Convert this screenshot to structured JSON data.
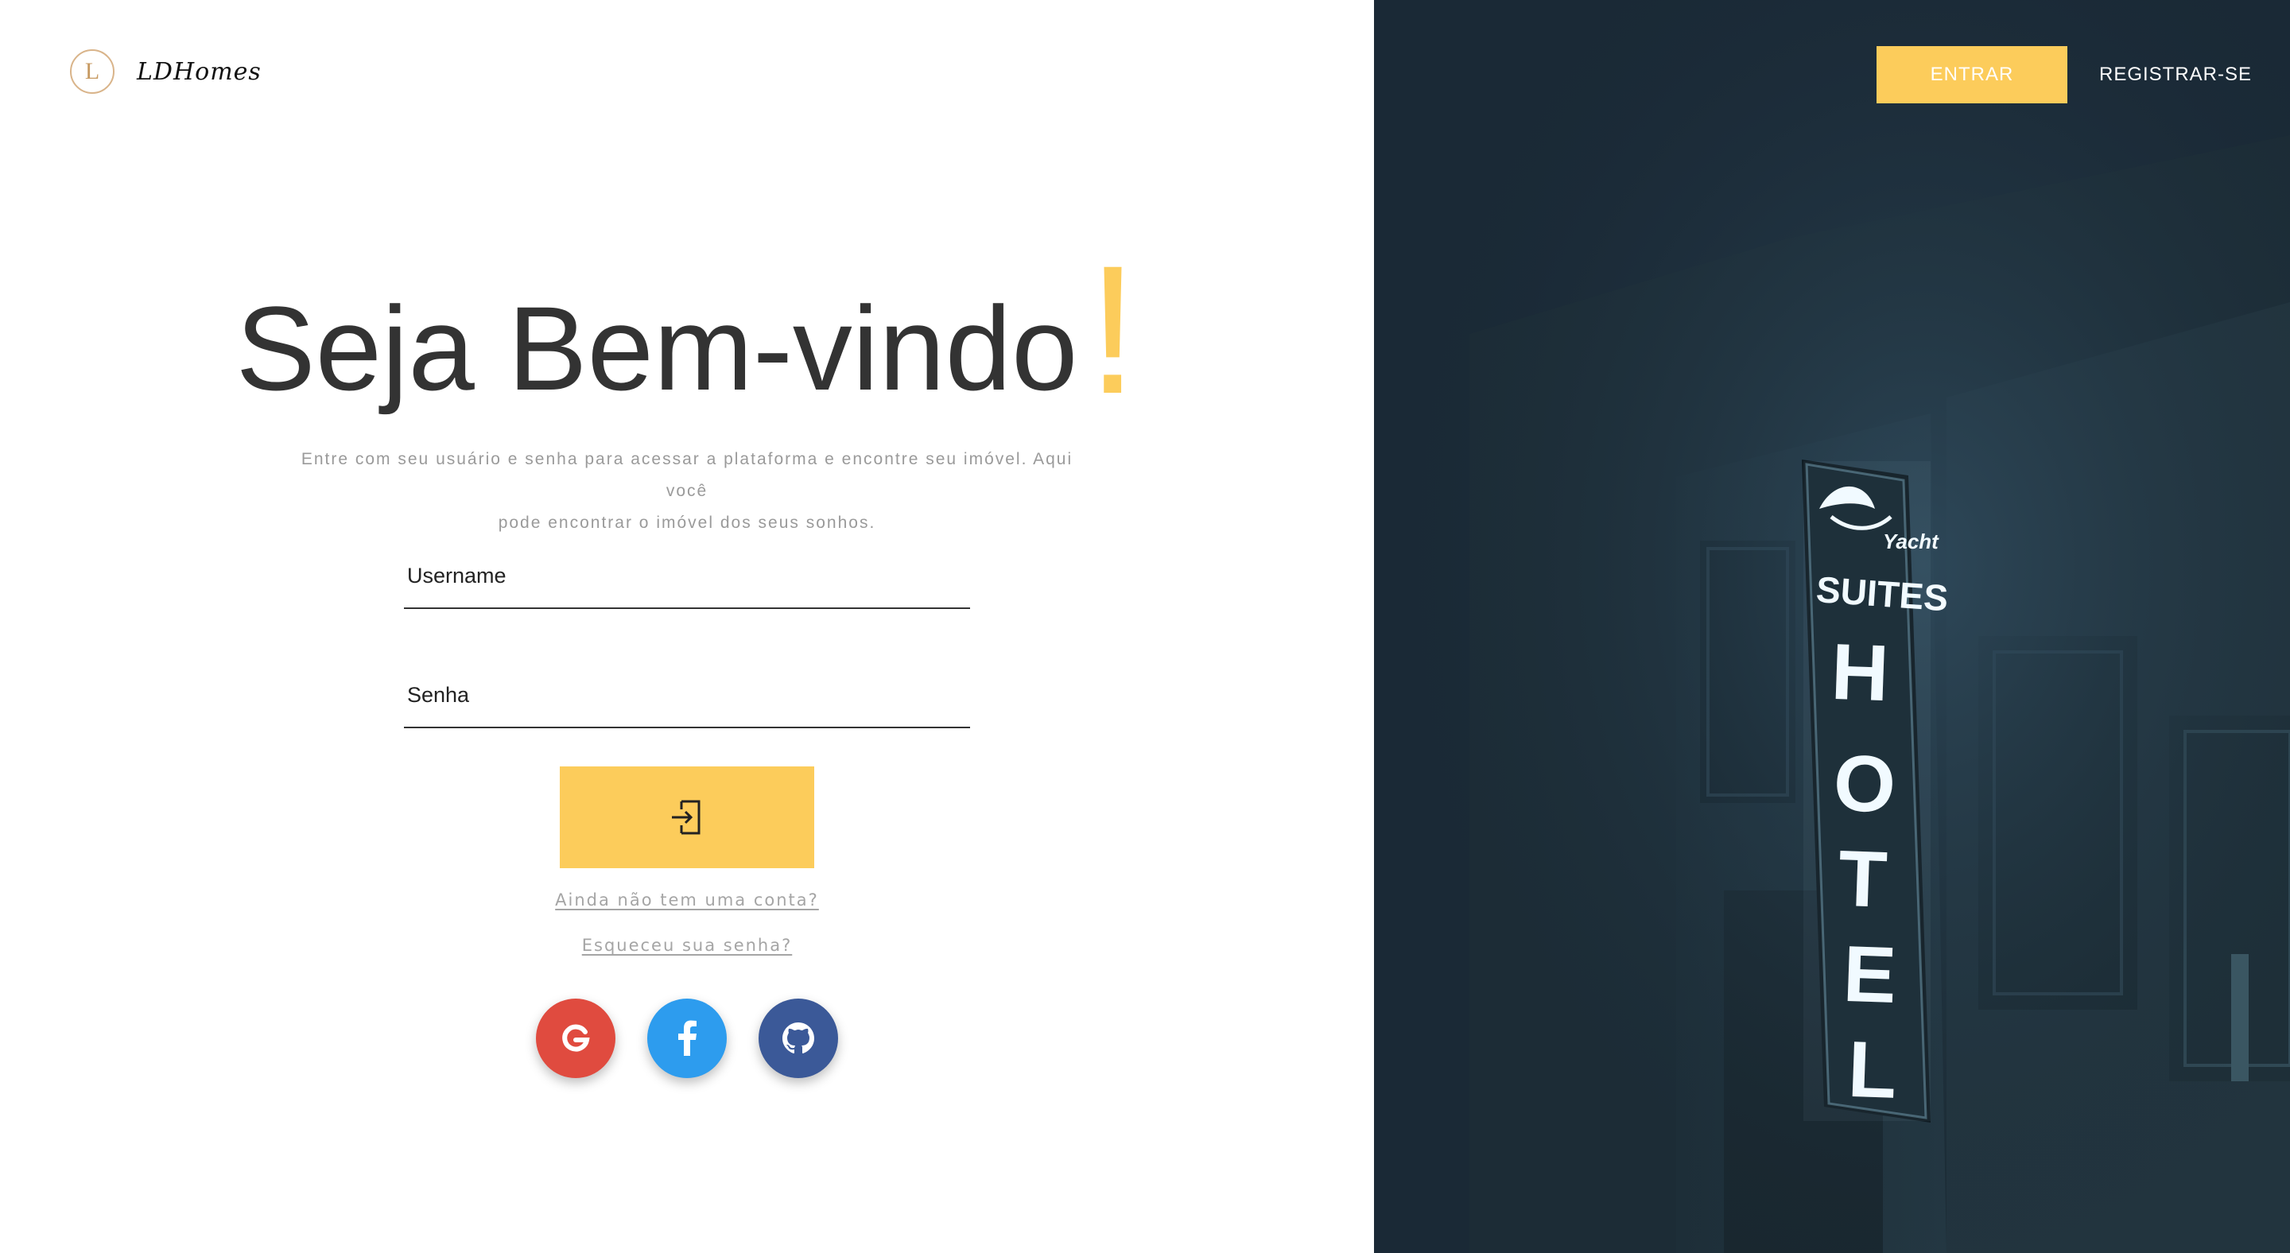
{
  "brand": {
    "logo_letter": "L",
    "name": "LDHomes"
  },
  "hero": {
    "title": "Seja Bem-vindo",
    "title_accent": "!",
    "subtitle_line1": "Entre com seu usuário e senha para acessar a plataforma e encontre seu imóvel. Aqui você",
    "subtitle_line2": "pode encontrar o imóvel dos seus sonhos."
  },
  "form": {
    "username_placeholder": "Username",
    "username_value": "",
    "password_placeholder": "Senha",
    "password_value": "",
    "submit_icon": "login-icon"
  },
  "links": {
    "register": "Ainda não tem uma conta?",
    "forgot": "Esqueceu sua senha?"
  },
  "socials": [
    {
      "name": "google",
      "icon": "google-icon",
      "color": "#e04b3f"
    },
    {
      "name": "facebook",
      "icon": "facebook-icon",
      "color": "#2d9cee"
    },
    {
      "name": "github",
      "icon": "github-icon",
      "color": "#3b5998"
    }
  ],
  "nav": {
    "login_label": "ENTRAR",
    "register_label": "REGISTRAR-SE"
  },
  "colors": {
    "accent": "#fccc5b",
    "text_dark": "#333333",
    "panel_dark": "#1b2a38"
  }
}
